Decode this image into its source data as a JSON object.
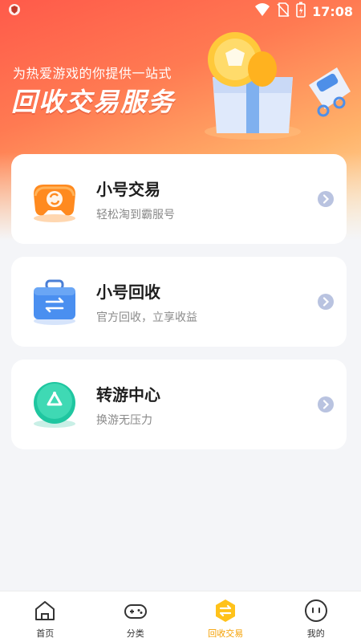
{
  "status_bar": {
    "time": "17:08"
  },
  "banner": {
    "subtitle": "为热爱游戏的你提供一站式",
    "title": "回收交易服务"
  },
  "cards": [
    {
      "title": "小号交易",
      "subtitle": "轻松淘到霸服号",
      "icon": "gamepad-refresh-icon"
    },
    {
      "title": "小号回收",
      "subtitle": "官方回收，立享收益",
      "icon": "bag-swap-icon"
    },
    {
      "title": "转游中心",
      "subtitle": "换游无压力",
      "icon": "recycle-coin-icon"
    }
  ],
  "tabbar": {
    "items": [
      {
        "label": "首页",
        "icon": "home-icon"
      },
      {
        "label": "分类",
        "icon": "gamepad-icon"
      },
      {
        "label": "回收交易",
        "icon": "swap-icon",
        "active": true
      },
      {
        "label": "我的",
        "icon": "profile-icon"
      }
    ]
  },
  "colors": {
    "accent": "#f5a000",
    "banner_start": "#ff5a4a",
    "banner_end": "#ffe2b0",
    "arrow": "#b9c3e0"
  }
}
